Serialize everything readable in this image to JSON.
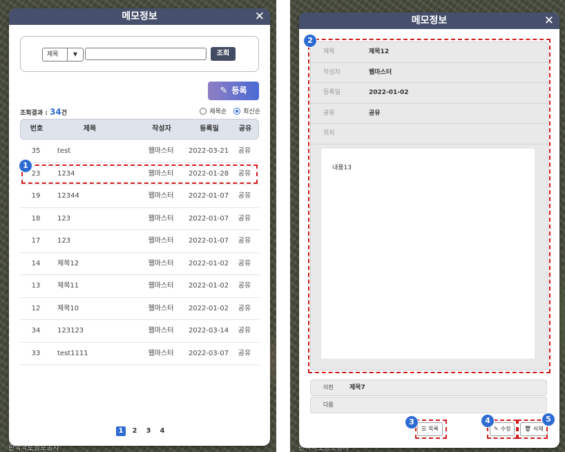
{
  "left_panel": {
    "title": "메모정보",
    "search": {
      "select_value": "제목",
      "input_value": "",
      "button": "조회"
    },
    "register_button": "등록",
    "result_label": "조회결과 :",
    "result_count": "34",
    "result_unit": "건",
    "sort_options": [
      {
        "label": "제목순",
        "selected": false
      },
      {
        "label": "최신순",
        "selected": true
      }
    ],
    "columns": [
      "번호",
      "제목",
      "작성자",
      "등록일",
      "공유"
    ],
    "rows": [
      {
        "no": "35",
        "title": "test",
        "writer": "웹마스터",
        "date": "2022-03-21",
        "share": "공유"
      },
      {
        "no": "23",
        "title": "1234",
        "writer": "웹마스터",
        "date": "2022-01-28",
        "share": "공유"
      },
      {
        "no": "19",
        "title": "12344",
        "writer": "웹마스터",
        "date": "2022-01-07",
        "share": "공유"
      },
      {
        "no": "18",
        "title": "123",
        "writer": "웹마스터",
        "date": "2022-01-07",
        "share": "공유"
      },
      {
        "no": "17",
        "title": "123",
        "writer": "웹마스터",
        "date": "2022-01-07",
        "share": "공유"
      },
      {
        "no": "14",
        "title": "제목12",
        "writer": "웹마스터",
        "date": "2022-01-02",
        "share": "공유"
      },
      {
        "no": "13",
        "title": "제목11",
        "writer": "웹마스터",
        "date": "2022-01-02",
        "share": "공유"
      },
      {
        "no": "12",
        "title": "제목10",
        "writer": "웹마스터",
        "date": "2022-01-02",
        "share": "공유"
      },
      {
        "no": "34",
        "title": "123123",
        "writer": "웹마스터",
        "date": "2022-03-14",
        "share": "공유"
      },
      {
        "no": "33",
        "title": "test1111",
        "writer": "웹마스터",
        "date": "2022-03-07",
        "share": "공유"
      }
    ],
    "pages": [
      "1",
      "2",
      "3",
      "4"
    ],
    "current_page": "1"
  },
  "right_panel": {
    "title": "메모정보",
    "fields": [
      {
        "label": "제목",
        "value": "제목12"
      },
      {
        "label": "작성자",
        "value": "웹마스터"
      },
      {
        "label": "등록일",
        "value": "2022-01-02"
      },
      {
        "label": "공유",
        "value": "공유"
      },
      {
        "label": "위치",
        "value": ""
      }
    ],
    "content": "내용13",
    "prev_label": "이전",
    "prev_value": "제목7",
    "next_label": "다음",
    "next_value": "",
    "list_button": "목록",
    "edit_button": "수정",
    "delete_button": "삭제"
  },
  "markers": [
    "1",
    "2",
    "3",
    "4",
    "5"
  ],
  "map_captions": [
    "한국국토정보공사",
    "한국국토정보공사"
  ],
  "colors": {
    "accent": "#2d6bd3",
    "titlebar": "#46506c",
    "highlight": "#d01818"
  }
}
